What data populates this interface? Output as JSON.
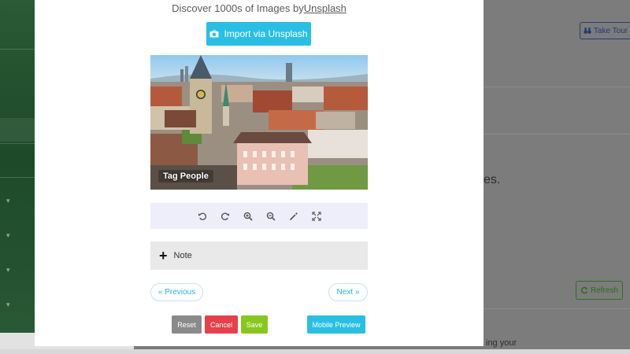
{
  "background": {
    "tour_button": "Take Tour",
    "refresh_button": "Refresh",
    "partial_text_1": "es.",
    "partial_text_2": "ing your"
  },
  "modal": {
    "header_prefix": "Discover 1000s of Images by",
    "header_link": "Unsplash",
    "import_button": "Import via Unsplash",
    "tag_people": "Tag People",
    "note_label": "Note",
    "previous_button": "« Previous",
    "next_button": "Next »",
    "reset_button": "Reset",
    "cancel_button": "Cancel",
    "save_button": "Save",
    "mobile_preview_button": "Mobile Preview"
  },
  "icons": {
    "import": "camera-icon",
    "tour": "binoculars-icon",
    "refresh": "refresh-icon",
    "note": "plus-icon",
    "toolbar": [
      "rotate-left-icon",
      "rotate-right-icon",
      "zoom-in-icon",
      "zoom-out-icon",
      "magic-wand-icon",
      "fullscreen-icon"
    ]
  },
  "colors": {
    "import_button": "#29bfe4",
    "reset_button": "#8a8a8a",
    "cancel_button": "#e8404a",
    "save_button": "#86c81e",
    "mobile_preview_button": "#29bfe4",
    "toolbar_bg": "#eeeefb",
    "sidebar": "#245231"
  }
}
